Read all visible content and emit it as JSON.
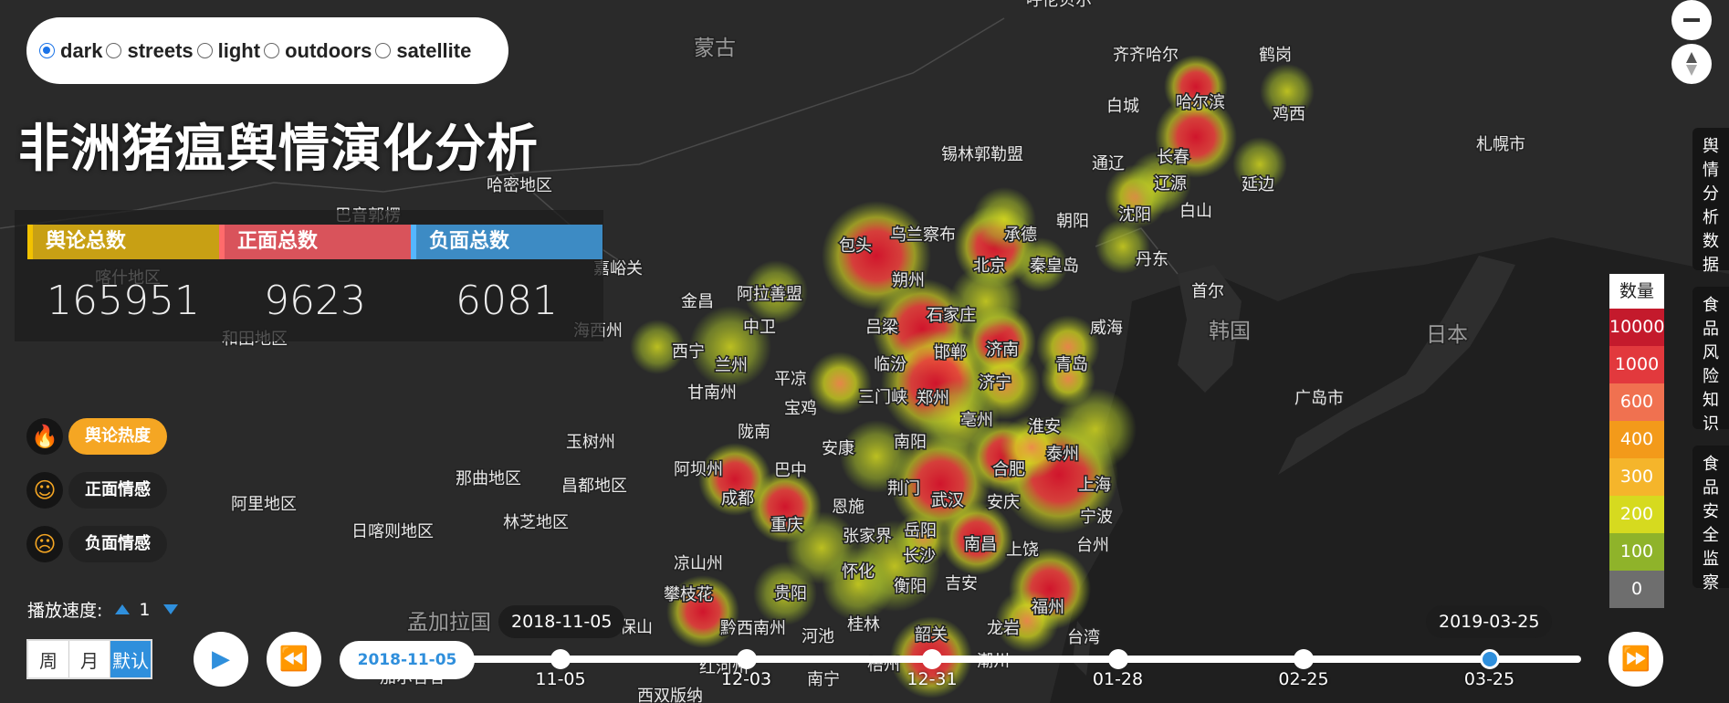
{
  "colors": {
    "accent": "#2f8fdc",
    "hot": "#f5a623"
  },
  "map_style": {
    "options": [
      "dark",
      "streets",
      "light",
      "outdoors",
      "satellite"
    ],
    "selected": "dark"
  },
  "title": "非洲猪瘟舆情演化分析",
  "stats": [
    {
      "label": "舆论总数",
      "value": "165951",
      "color": "#c8a014"
    },
    {
      "label": "正面总数",
      "value": "9623",
      "color": "#d9535b"
    },
    {
      "label": "负面总数",
      "value": "6081",
      "color": "#3d8bc4"
    }
  ],
  "layers": [
    {
      "label": "舆论热度",
      "icon": "flame-icon",
      "active": true
    },
    {
      "label": "正面情感",
      "icon": "smile-icon",
      "active": false
    },
    {
      "label": "负面情感",
      "icon": "frown-icon",
      "active": false
    }
  ],
  "speed": {
    "label": "播放速度:",
    "value": "1"
  },
  "period": [
    "周",
    "月",
    "默认"
  ],
  "timeline": {
    "current": "2018-11-05",
    "start_bubble": "2018-11-05",
    "end_bubble": "2019-03-25",
    "ticks": [
      "11-05",
      "12-03",
      "12-31",
      "01-28",
      "02-25",
      "03-25"
    ],
    "selected_index": 5
  },
  "side_tabs": [
    "舆情分析数据",
    "食品风险知识",
    "食品安全监察"
  ],
  "legend": {
    "title": "数量",
    "items": [
      {
        "label": "10000",
        "color": "#c41a2c"
      },
      {
        "label": "1000",
        "color": "#e2393d"
      },
      {
        "label": "600",
        "color": "#f07150"
      },
      {
        "label": "400",
        "color": "#f39a1a"
      },
      {
        "label": "300",
        "color": "#f5b52b"
      },
      {
        "label": "200",
        "color": "#d6da1f"
      },
      {
        "label": "100",
        "color": "#8fb32a"
      },
      {
        "label": "0",
        "color": "#6e6e6e"
      }
    ]
  },
  "map_labels": [
    "呼伦贝尔",
    "蒙古",
    "齐齐哈尔",
    "鹤岗",
    "哈尔滨",
    "白城",
    "鸡西",
    "锡林郭勒盟",
    "通辽",
    "长春",
    "辽源",
    "延边",
    "白山",
    "沈阳",
    "朝阳",
    "承德",
    "乌兰察布",
    "包头",
    "北京",
    "秦皇岛",
    "丹东",
    "札幌市",
    "哈密地区",
    "巴音郭楞",
    "嘉峪关",
    "金昌",
    "阿拉善盟",
    "朔州",
    "石家庄",
    "首尔",
    "喀什地区",
    "吕梁",
    "中卫",
    "威海",
    "和田地区",
    "海西州",
    "西宁",
    "兰州",
    "邯郸",
    "济南",
    "青岛",
    "韩国",
    "日本",
    "甘南州",
    "平凉",
    "临汾",
    "济宁",
    "广岛市",
    "宝鸡",
    "三门峡",
    "郑州",
    "亳州",
    "陇南",
    "淮安",
    "安康",
    "南阳",
    "泰州",
    "玉树州",
    "合肥",
    "上海",
    "阿坝州",
    "巴中",
    "那曲地区",
    "昌都地区",
    "荆门",
    "武汉",
    "安庆",
    "成都",
    "宁波",
    "阿里地区",
    "恩施",
    "重庆",
    "岳阳",
    "南昌",
    "日喀则地区",
    "林芝地区",
    "张家界",
    "台州",
    "上饶",
    "长沙",
    "凉山州",
    "怀化",
    "衡阳",
    "吉安",
    "福州",
    "攀枝花",
    "贵阳",
    "保山",
    "孟加拉国",
    "黔西南州",
    "河池",
    "桂林",
    "韶关",
    "龙岩",
    "台湾",
    "红河州",
    "梧州",
    "潮州",
    "南宁",
    "西双版纳",
    "加尔各答"
  ]
}
